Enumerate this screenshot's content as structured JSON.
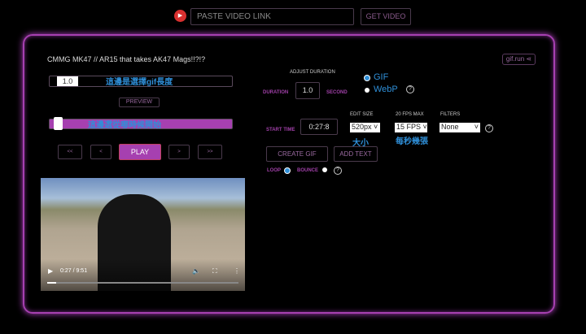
{
  "header": {
    "youtube_icon": "youtube-icon",
    "link_placeholder": "PASTE VIDEO LINK",
    "get_video": "GET VIDEO"
  },
  "video_title": "CMMG MK47 // AR15 that takes AK47 Mags!!?!?",
  "brand": "gif.run",
  "duration_slider": {
    "value": "1.0",
    "annotation": "這邊是選擇gif長度"
  },
  "preview": "PREVIEW",
  "start_slider": {
    "annotation": "這邊選從哪時候開始",
    "progress_percent": 4.7
  },
  "nav": {
    "back_far": "<<",
    "back": "<",
    "play": "PLAY",
    "fwd": ">",
    "fwd_far": ">>"
  },
  "player": {
    "time": "0:27 / 9:51",
    "progress_percent": 4.6
  },
  "adjust": {
    "heading": "ADJUST  DURATION",
    "duration_label": "DURATION",
    "duration_value": "1.0",
    "second_label": "SECOND"
  },
  "format": {
    "gif": "GIF",
    "webp": "WebP",
    "selected": "GIF"
  },
  "start": {
    "label": "START TIME",
    "value": "0:27:8"
  },
  "edit_size": {
    "label": "EDIT SIZE",
    "value": "520px",
    "annotation": "大小"
  },
  "fps": {
    "label": "20 FPS MAX",
    "value": "15 FPS",
    "annotation": "每秒幾張"
  },
  "filters": {
    "label": "FILTERS",
    "value": "None"
  },
  "actions": {
    "create": "CREATE GIF",
    "add_text": "ADD TEXT"
  },
  "mode": {
    "loop": "LOOP",
    "bounce": "BOUNCE",
    "selected": "LOOP"
  },
  "colors": {
    "accent": "#a640b0",
    "blue": "#2f8fd8"
  }
}
